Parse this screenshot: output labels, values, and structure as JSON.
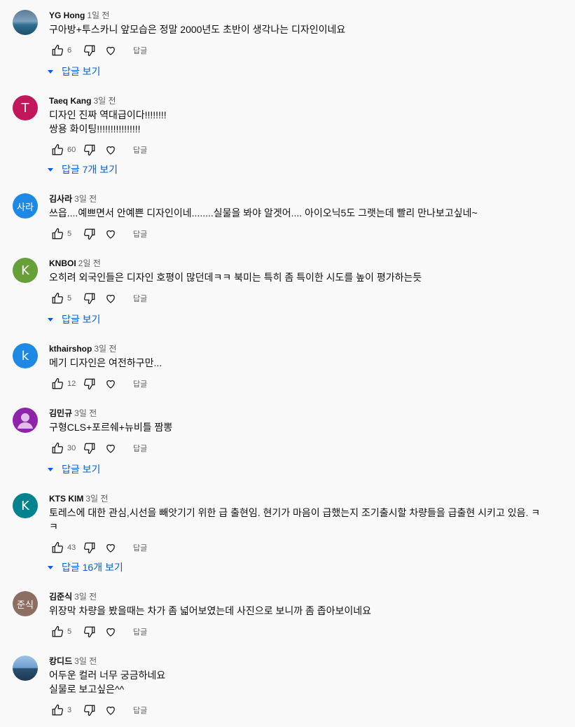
{
  "comments": [
    {
      "author": "YG Hong",
      "time": "1일 전",
      "text": "구아방+투스카니 앞모습은 정말 2000년도 초반이 생각나는 디자인이네요",
      "likes": "6",
      "reply": "답글",
      "replies_label": "답글 보기",
      "avatar_text": "",
      "avatar_color": "#3a5b78",
      "avatar_icon": "pool-photo-icon"
    },
    {
      "author": "Taeq Kang",
      "time": "3일 전",
      "text": "디자인 진짜 역대급이다!!!!!!!!\n쌍용 화이팅!!!!!!!!!!!!!!!!",
      "likes": "60",
      "reply": "답글",
      "replies_label": "답글 7개 보기",
      "avatar_text": "T",
      "avatar_color": "#c2185b"
    },
    {
      "author": "김사라",
      "time": "3일 전",
      "text": "쓰읍....예쁘면서 안예쁜 디자인이네........실물을 봐야 알겟어.... 아이오닉5도 그랫는데 빨리 만나보고싶네~",
      "likes": "5",
      "reply": "답글",
      "replies_label": "",
      "avatar_text": "사라",
      "avatar_color": "#1e88e5"
    },
    {
      "author": "KNBOI",
      "time": "2일 전",
      "text": "오히려 외국인들은 디자인 호평이 많던데ㅋㅋ 북미는 특히 좀 특이한 시도를 높이 평가하는듯",
      "likes": "5",
      "reply": "답글",
      "replies_label": "답글 보기",
      "avatar_text": "K",
      "avatar_color": "#689f38"
    },
    {
      "author": "kthairshop",
      "time": "3일 전",
      "text": "메기 디자인은 여전하구만...",
      "likes": "12",
      "reply": "답글",
      "replies_label": "",
      "avatar_text": "k",
      "avatar_color": "#1e88e5"
    },
    {
      "author": "김민규",
      "time": "3일 전",
      "text": "구형CLS+포르쉐+뉴비틀 짬뽕",
      "likes": "30",
      "reply": "답글",
      "replies_label": "답글 보기",
      "avatar_text": "",
      "avatar_color": "#8e24aa",
      "avatar_icon": "person-icon"
    },
    {
      "author": "KTS KIM",
      "time": "3일 전",
      "text": "토레스에 대한 관심,시선을 빼앗기기 위한 급 출현임. 현기가 마음이 급했는지 조기출시할 차량들을 급출현 시키고 있음.  ㅋ\nㅋ",
      "likes": "43",
      "reply": "답글",
      "replies_label": "답글 16개 보기",
      "avatar_text": "K",
      "avatar_color": "#00838f"
    },
    {
      "author": "김준식",
      "time": "3일 전",
      "text": "위장막 차량을 봤을때는 차가 좀 넓어보였는데 사진으로 보니까 좀 좁아보이네요",
      "likes": "5",
      "reply": "답글",
      "replies_label": "",
      "avatar_text": "준식",
      "avatar_color": "#8d6e63"
    },
    {
      "author": "캉디드",
      "time": "3일 전",
      "text": "어두운 컬러 너무 궁금하네요\n실물로 보고싶은^^",
      "likes": "3",
      "reply": "답글",
      "replies_label": "",
      "avatar_text": "",
      "avatar_color": "#5b7ea0",
      "avatar_icon": "sea-photo-icon"
    }
  ]
}
